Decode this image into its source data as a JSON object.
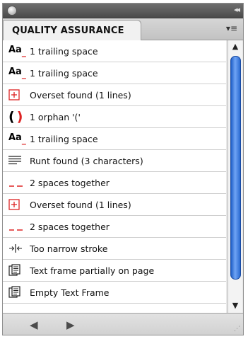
{
  "panel": {
    "tab_label": "QUALITY ASSURANCE",
    "menu_glyph": "▾≡",
    "collapse_glyph": "◂◂"
  },
  "rows": [
    {
      "icon": "trailing-space-icon",
      "text": "1 trailing space"
    },
    {
      "icon": "trailing-space-icon",
      "text": "1 trailing space"
    },
    {
      "icon": "overset-icon",
      "text": "Overset found (1 lines)"
    },
    {
      "icon": "orphan-icon",
      "text": "1 orphan '('"
    },
    {
      "icon": "trailing-space-icon",
      "text": "1 trailing space"
    },
    {
      "icon": "runt-icon",
      "text": "Runt found (3 characters)"
    },
    {
      "icon": "double-space-icon",
      "text": "2 spaces together"
    },
    {
      "icon": "overset-icon",
      "text": "Overset found (1 lines)"
    },
    {
      "icon": "double-space-icon",
      "text": "2 spaces together"
    },
    {
      "icon": "narrow-stroke-icon",
      "text": "Too narrow stroke"
    },
    {
      "icon": "text-frame-icon",
      "text": "Text frame partially on page"
    },
    {
      "icon": "text-frame-icon",
      "text": "Empty Text Frame"
    }
  ],
  "icons": {
    "aa_text": "Aa",
    "aa_sub": "_",
    "orphan_text": "( )",
    "double_space": "_ _"
  },
  "nav": {
    "prev": "◀",
    "next": "▶"
  },
  "colors": {
    "accent_red": "#dd2222",
    "scroll_blue": "#2a6ad0"
  }
}
